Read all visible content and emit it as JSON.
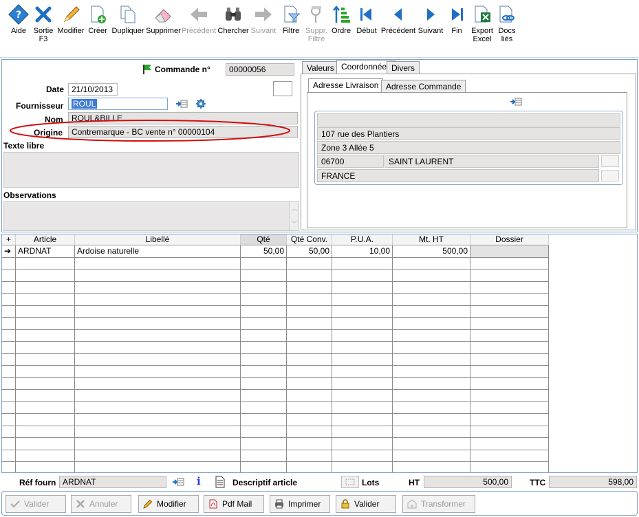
{
  "toolbar": {
    "items": [
      {
        "label": "Aide",
        "icon": "help-icon",
        "enabled": true
      },
      {
        "label": "Sortie\nF3",
        "icon": "exit-icon",
        "enabled": true
      },
      {
        "label": "Modifier",
        "icon": "pencil-icon",
        "enabled": true
      },
      {
        "label": "Créer",
        "icon": "new-document-icon",
        "enabled": true
      },
      {
        "label": "Dupliquer",
        "icon": "duplicate-icon",
        "enabled": true
      },
      {
        "label": "Supprimer",
        "icon": "eraser-icon",
        "enabled": true
      },
      {
        "label": "Précédent",
        "icon": "arrow-left-icon",
        "enabled": false
      },
      {
        "label": "Chercher",
        "icon": "binoculars-icon",
        "enabled": true
      },
      {
        "label": "Suivant",
        "icon": "arrow-right-icon",
        "enabled": false
      },
      {
        "label": "Filtre",
        "icon": "filter-icon",
        "enabled": true
      },
      {
        "label": "Suppr.\nFiltre",
        "icon": "remove-filter-icon",
        "enabled": false
      },
      {
        "label": "Ordre",
        "icon": "sort-order-icon",
        "enabled": true
      },
      {
        "label": "Début",
        "icon": "first-record-icon",
        "enabled": true
      },
      {
        "label": "Précédent",
        "icon": "previous-record-icon",
        "enabled": true
      },
      {
        "label": "Suivant",
        "icon": "next-record-icon",
        "enabled": true
      },
      {
        "label": "Fin",
        "icon": "last-record-icon",
        "enabled": true
      },
      {
        "label": "Export\nExcel",
        "icon": "excel-export-icon",
        "enabled": true
      },
      {
        "label": "Docs\nliés",
        "icon": "linked-docs-icon",
        "enabled": true
      }
    ]
  },
  "header": {
    "commande_label": "Commande n°",
    "commande_value": "00000056",
    "date_label": "Date",
    "date_value": "21/10/2013",
    "fournisseur_label": "Fournisseur",
    "fournisseur_value": "ROUL",
    "nom_label": "Nom",
    "nom_value": "ROUL&BILLE",
    "origine_label": "Origine",
    "origine_value": "Contremarque - BC vente n° 00000104",
    "texte_libre_label": "Texte libre",
    "observations_label": "Observations"
  },
  "tabs": {
    "main": [
      "Valeurs",
      "Coordonnées",
      "Divers"
    ],
    "active_main": "Coordonnées",
    "sub": [
      "Adresse Livraison",
      "Adresse Commande"
    ],
    "active_sub": "Adresse Livraison"
  },
  "address": {
    "line1": "",
    "line2": "107 rue des Plantiers",
    "line3": "Zone 3  Allée 5",
    "postcode": "06700",
    "city": "SAINT LAURENT",
    "country": "FRANCE"
  },
  "grid": {
    "add_symbol": "+",
    "columns": [
      "Article",
      "Libellé",
      "Qté",
      "Qté Conv.",
      "P.U.A.",
      "Mt. HT",
      "Dossier"
    ],
    "rows": [
      {
        "marker": "➔",
        "article": "ARDNAT",
        "libelle": "Ardoise naturelle",
        "qte": "50,00",
        "qte_conv": "50,00",
        "pua": "10,00",
        "mt_ht": "500,00",
        "dossier": ""
      }
    ]
  },
  "footer": {
    "ref_fourn_label": "Réf fourn",
    "ref_fourn_value": "ARDNAT",
    "info_symbol": "i",
    "descriptif_label": "Descriptif article",
    "lots_label": "Lots",
    "ht_label": "HT",
    "ht_value": "500,00",
    "ttc_label": "TTC",
    "ttc_value": "598,00"
  },
  "buttons": [
    {
      "label": "Valider",
      "enabled": false,
      "icon": "check-icon"
    },
    {
      "label": "Annuler",
      "enabled": false,
      "icon": "cancel-icon"
    },
    {
      "label": "Modifier",
      "enabled": true,
      "icon": "pencil-icon"
    },
    {
      "label": "Pdf Mail",
      "enabled": true,
      "icon": "pdf-icon"
    },
    {
      "label": "Imprimer",
      "enabled": true,
      "icon": "printer-icon"
    },
    {
      "label": "Valider",
      "enabled": true,
      "icon": "lock-icon"
    },
    {
      "label": "Transformer",
      "enabled": false,
      "icon": "transform-icon"
    }
  ],
  "colors": {
    "accent_blue": "#1f6fc5",
    "flag_green": "#2fa52f",
    "highlight_red": "#d01010",
    "field_gray": "#e6e3e3",
    "selection_blue": "#3d7bd6"
  }
}
